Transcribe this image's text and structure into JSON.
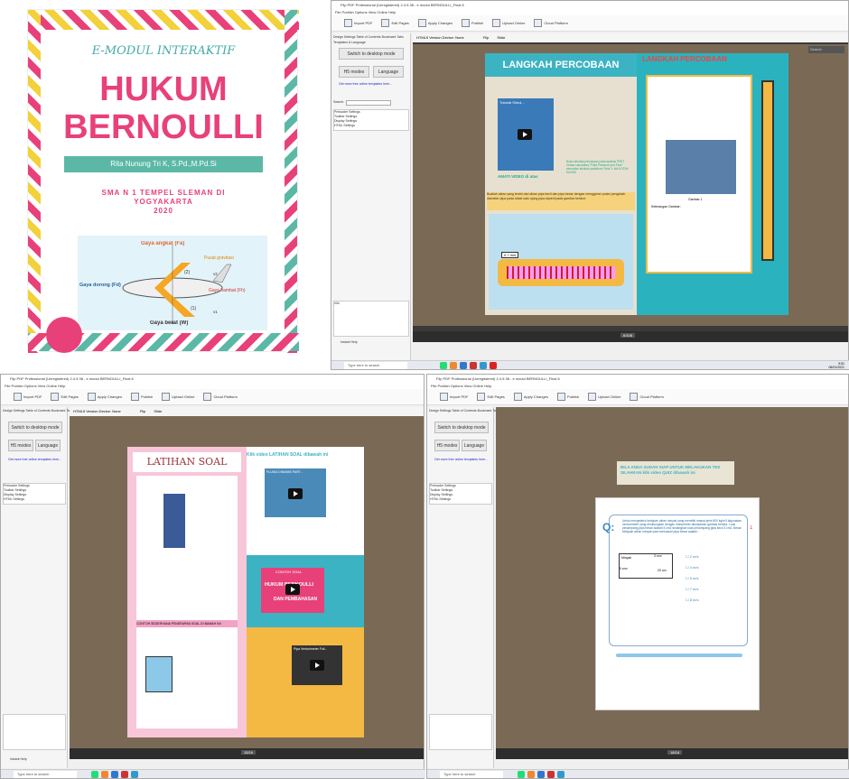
{
  "cover": {
    "top_title": "E-MODUL INTERAKTIF",
    "title_line1": "HUKUM",
    "title_line2": "BERNOULLI",
    "author": "Rita Nunung Tri K, S.Pd.,M.Pd.Si",
    "school_line1": "SMA N 1 TEMPEL SLEMAN DI",
    "school_line2": "YOGYAKARTA",
    "school_line3": "2020",
    "diagram": {
      "lift": "Gaya angkat (Fa)",
      "gravity": "Pusat gravitasi",
      "thrust": "Gaya dorong (Fd)",
      "drag": "Gaya hambat (Fh)",
      "weight": "Gaya berat (W)",
      "label1": "(1)",
      "label2": "(2)",
      "v1": "v1",
      "v2": "v2"
    }
  },
  "app": {
    "title": "Flip PDF Professional (Unregistered) 2.4.9.38 - e modul BERNOULLI_Final 6",
    "menu": "File  Publish  Options  View  Online  Help",
    "toolbar": [
      "Import PDF",
      "Edit Pages",
      "Apply Changes",
      "Publish",
      "Upload Online",
      "Cloud Platform"
    ],
    "tabs": "Design Settings  Table of Contents  Bookmark Tabs",
    "templates": "Templates & Language",
    "switch_btn": "Switch to desktop mode",
    "html5_btn": "H5 modes",
    "language_btn": "Language",
    "link": "Get more free online templates here...",
    "search_label": "Search:",
    "settings": [
      "Preloader Settings",
      "Toolbar Settings",
      "Display Settings",
      "HTML Settings"
    ],
    "info": "Info",
    "instant_help": "Instant Help",
    "viewer_tabs": "HTML5 Version   Device:  None",
    "flip_label": "Flip",
    "slide_label": "Slide",
    "search_box": "Search",
    "page_indicator": "6/108",
    "page_indicator2": "15/16",
    "page_indicator3": "18/18"
  },
  "screen1": {
    "left_title": "LANGKAH PERCOBAAN",
    "right_title": "LANGKAH PERCOBAAN",
    "video_label": "Tutorial Simul...",
    "watch": "AMATI VIDEO di atas",
    "note": "Buka simulasi percobaan pada aplikasi PHET Virtual Laboratory \"Fluid Pressure and Flow\" kemudian lakukan praktikum \"flow\"1. klik KOTAK DIATAS",
    "instruction": "Buatlah aliran yang terdiri dari aliran pipa kecil dan pipa besar dengan menggeser posisi pengubah diameter pipa pada sekat satu ujung pipa seperti pada gambar berikut:",
    "reading": "0.7 m/s",
    "caption": "Gambar 1",
    "steps_title": "Keterangan Gambar:"
  },
  "screen2": {
    "left_title": "LATIHAN SOAL",
    "right_banner": "Klik video LATIHAN SOAL dibawah ini",
    "video1": "FLUIDA DINAMIS PART...",
    "video2": "CONTOH SOAL",
    "video2b": "HUKUM BERNOULLI",
    "video2c": "DAN PEMBAHASAN",
    "video3": "Pipa Venturimeter Foli...",
    "section": "CONTOH SEDERHANA PENERAPAN SOAL DI BAWAH INI"
  },
  "screen3": {
    "banner": "BILA ANDA SUDAH SIAP UNTUK MELAKUKAN TES SILAHKAN klik video QUIZ dibawah ini",
    "question": "Untuk mengetahui kelajuan aliran minyak yang memiliki massa jenis 800 kg/m3 digunakan venturimeter yang dihubungkan dengan manometer ditunjukkan gambar berikut. Luas penampang pipa besar adalah 5 cm2 sedangkan luas penampang pipa kecil 3 cm2. Besar kelajuan aliran minyak saat memasuki pipa besar adalah...",
    "q_label": "Q:",
    "answers": [
      "2 m/s",
      "4 m/s",
      "5 m/s",
      "7 m/s",
      "8 m/s"
    ],
    "minyak": "Minyak",
    "area1": "5 cm²",
    "area2": "3 cm²",
    "height": "20 cm",
    "page_num": "1"
  },
  "taskbar": {
    "search": "Type here to search",
    "time": "9:51",
    "date": "06/01/2021"
  }
}
